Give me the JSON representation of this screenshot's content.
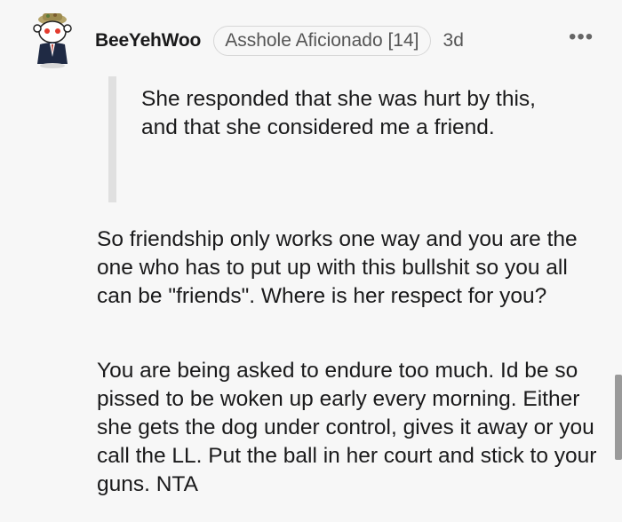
{
  "comment": {
    "username": "BeeYehWoo",
    "flair": "Asshole Aficionado [14]",
    "age": "3d",
    "more_label": "•••",
    "quote": "She responded that she was hurt by this, and that she considered me a friend.",
    "paragraphs": [
      "So friendship only works one way and you are the one who has to put up with this bullshit so you all can be \"friends\". Where is her respect for you?",
      "You are being asked to endure too much. Id be so pissed to be woken up early every morning. Either she gets the dog under control, gives it away or you call the LL. Put the ball in her court and stick to your guns. NTA"
    ]
  },
  "colors": {
    "background": "#f7f7f7",
    "text": "#1a1a1b",
    "muted": "#555555",
    "quote_bar": "#e0e0e0"
  },
  "icons": {
    "avatar": "snoo-avatar-icon",
    "more": "more-options-icon"
  }
}
